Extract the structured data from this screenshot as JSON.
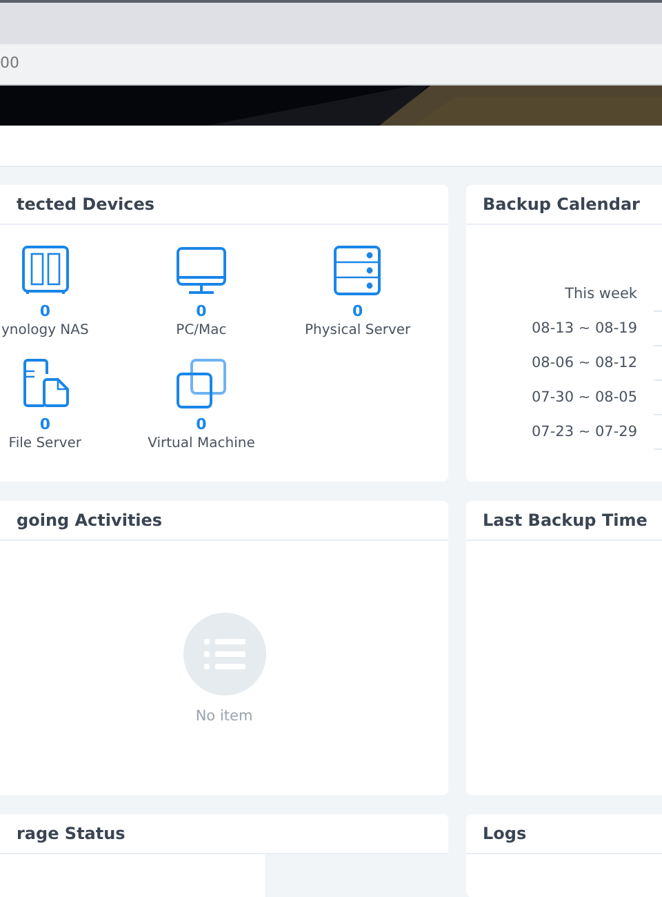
{
  "address_bar": {
    "text": "00"
  },
  "protected_devices": {
    "title": "tected Devices",
    "devices": [
      {
        "kind": "nas",
        "count": "0",
        "label": "ynology NAS"
      },
      {
        "kind": "pc",
        "count": "0",
        "label": "PC/Mac"
      },
      {
        "kind": "server",
        "count": "0",
        "label": "Physical Server"
      },
      {
        "kind": "file",
        "count": "0",
        "label": "File Server"
      },
      {
        "kind": "vm",
        "count": "0",
        "label": "Virtual Machine"
      }
    ]
  },
  "backup_calendar": {
    "title": "Backup Calendar",
    "weeks": [
      "This week",
      "08-13 ~ 08-19",
      "08-06 ~ 08-12",
      "07-30 ~ 08-05",
      "07-23 ~ 07-29"
    ]
  },
  "ongoing_activities": {
    "title": "going Activities",
    "empty_text": "No item"
  },
  "last_backup_time": {
    "title": "Last Backup Time"
  },
  "storage_status": {
    "title": "rage Status"
  },
  "logs": {
    "title": "Logs"
  }
}
